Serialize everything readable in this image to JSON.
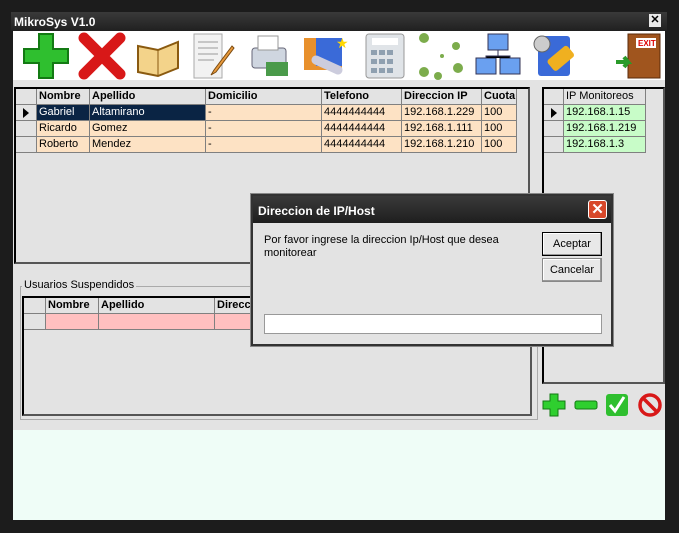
{
  "window": {
    "title": "MikroSys V1.0",
    "close": "✕"
  },
  "toolbar": {
    "icons": [
      "add-icon",
      "delete-icon",
      "book-icon",
      "document-edit-icon",
      "printer-icon",
      "telescope-icon",
      "calculator-icon",
      "network-dots-icon",
      "network-computers-icon",
      "settings-tool-icon",
      "exit-door-icon"
    ],
    "exit_label": "EXIT"
  },
  "users_grid": {
    "columns": [
      "Nombre",
      "Apellido",
      "Domicilio",
      "Telefono",
      "Direccion IP",
      "Cuota"
    ],
    "rows": [
      [
        "Gabriel",
        "Altamirano",
        "-",
        "4444444444",
        "192.168.1.229",
        "100"
      ],
      [
        "Ricardo",
        "Gomez",
        "-",
        "4444444444",
        "192.168.1.111",
        "100"
      ],
      [
        "Roberto",
        "Mendez",
        "-",
        "4444444444",
        "192.168.1.210",
        "100"
      ]
    ],
    "row_color": "#fde2c4"
  },
  "monitor_grid": {
    "columns": [
      "IP Monitoreos"
    ],
    "rows": [
      "192.168.1.15",
      "192.168.1.219",
      "192.168.1.3"
    ],
    "row_color": "#c8fcc8"
  },
  "monitor_actions": [
    "add-icon",
    "remove-icon",
    "check-icon",
    "cancel-icon"
  ],
  "suspended": {
    "label": "Usuarios Suspendidos",
    "columns": [
      "Nombre",
      "Apellido",
      "Direcci"
    ],
    "row_color": "#ffc0c0"
  },
  "dialog": {
    "title": "Direccion de IP/Host",
    "message": "Por favor ingrese la direccion Ip/Host que desea monitorear",
    "ok": "Aceptar",
    "cancel": "Cancelar",
    "input_value": "",
    "close": "✕"
  }
}
